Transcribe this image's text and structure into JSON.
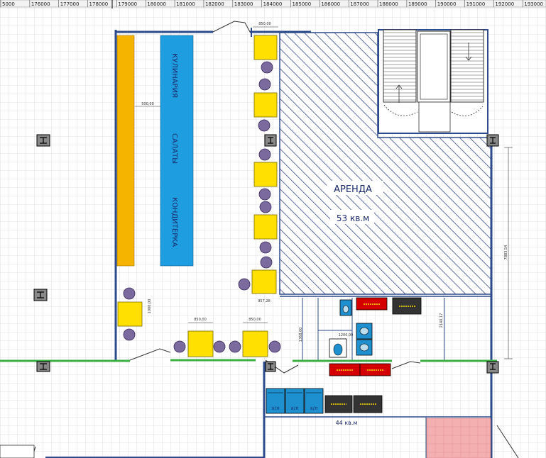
{
  "ruler": {
    "ticks": [
      "5000",
      "176000",
      "177000",
      "178000",
      "179000",
      "180000",
      "181000",
      "182000",
      "183000",
      "184000",
      "185000",
      "186000",
      "187000",
      "188000",
      "189000",
      "190000",
      "191000",
      "192000",
      "193000"
    ]
  },
  "labels": {
    "kulinariya": "КУЛИНАРИЯ",
    "salaty": "САЛАТЫ",
    "konditerka": "КОНДИТЕРКА",
    "arenda": "АРЕНДА",
    "arenda_area": "53 кв.м",
    "lower_area": "44 кв.м",
    "fridge": "х/л"
  },
  "dimensions": {
    "d_top": "850,00",
    "d_counter": "500,00",
    "d_table_v": "1000,00",
    "d_table_a": "850,00",
    "d_table_b": "850,00",
    "d_table_c": "957,28",
    "d_right": "7883,54",
    "d_wc1": "1200,00",
    "d_wc2": "2140,17",
    "d_wc3": "1368,00"
  },
  "colors": {
    "wall": "#2d4a8c",
    "glass": "#3cb043",
    "counter_orange": "#f5b400",
    "counter_blue": "#1e9ee0",
    "table_yellow": "#ffe000",
    "chair": "#7a6a9e",
    "equipment_red": "#d40000",
    "equipment_dark": "#333333",
    "fridge_blue": "#1e90d0",
    "hatch": "#3a4a8a",
    "pink_zone": "#f4b0b0"
  }
}
